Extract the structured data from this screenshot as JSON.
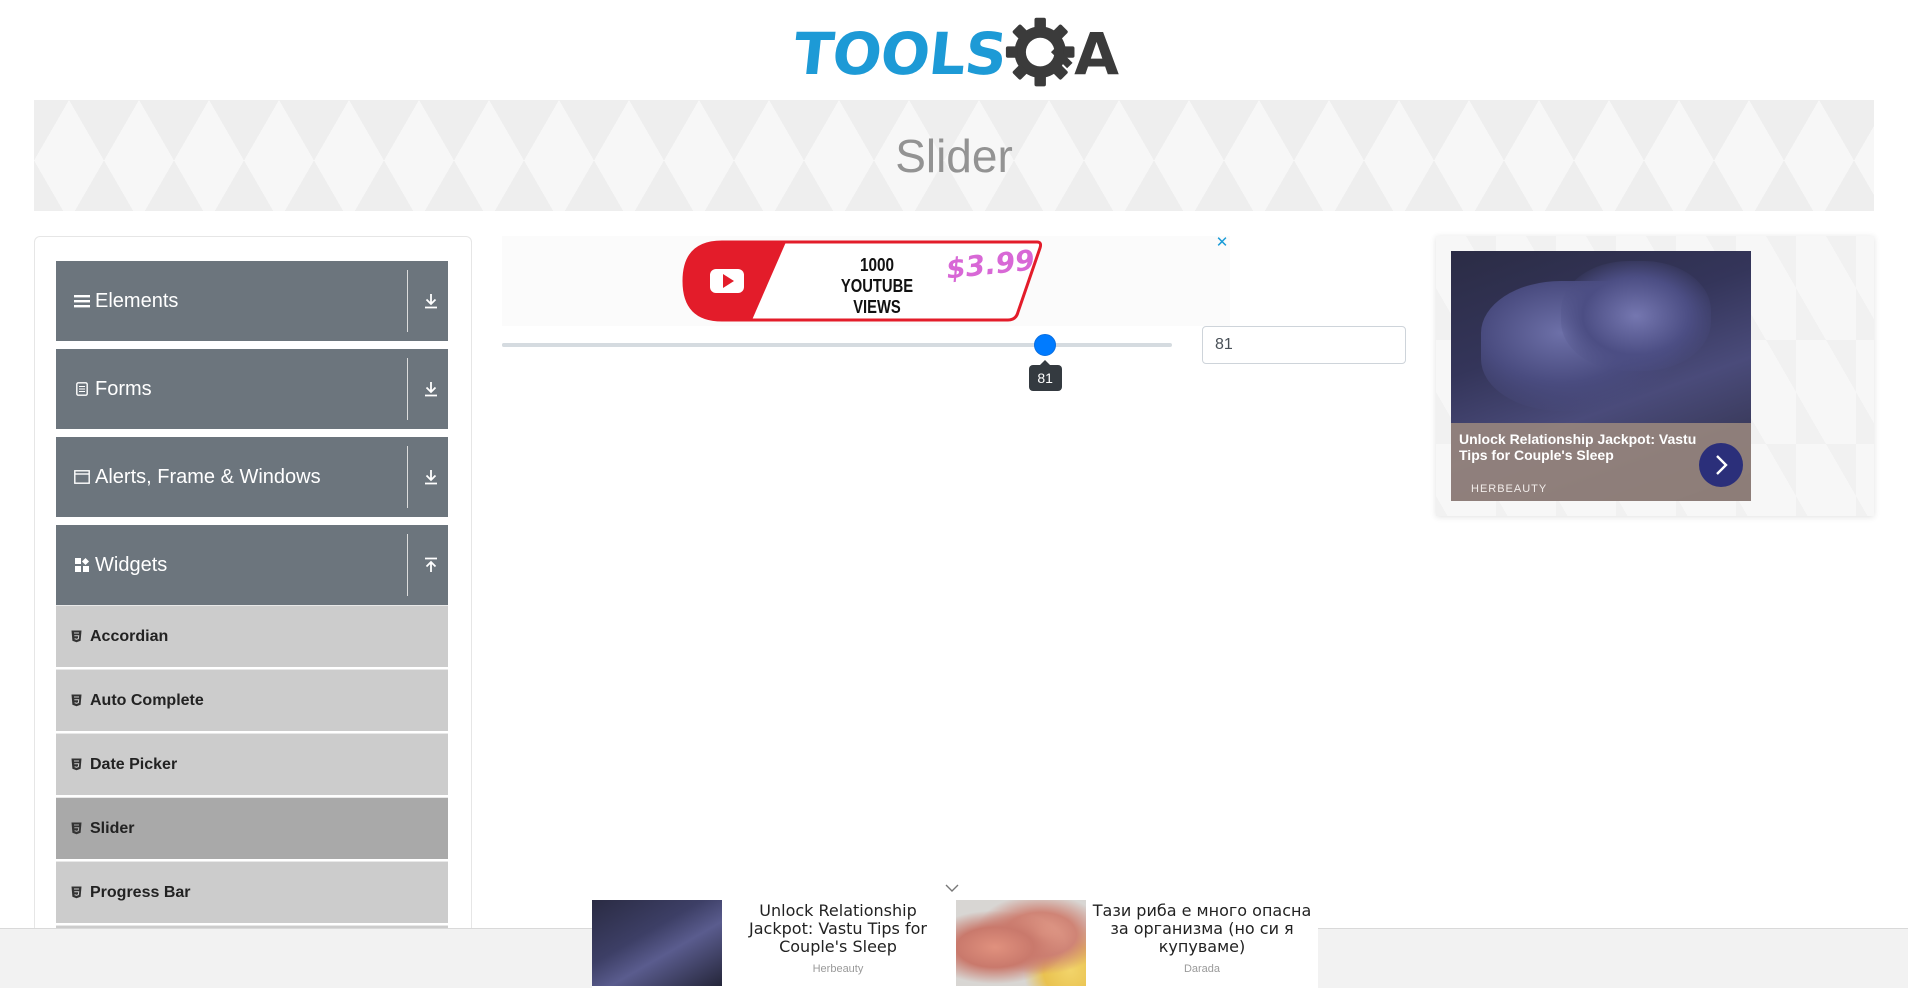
{
  "header": {
    "logo_tools": "TOOLS",
    "logo_a": "A"
  },
  "banner": {
    "title": "Slider"
  },
  "sidebar": {
    "groups": [
      {
        "label": "Elements",
        "icon": "list-icon",
        "state": "collapsed"
      },
      {
        "label": "Forms",
        "icon": "form-icon",
        "state": "collapsed"
      },
      {
        "label": "Alerts, Frame & Windows",
        "icon": "window-icon",
        "state": "collapsed"
      },
      {
        "label": "Widgets",
        "icon": "widgets-icon",
        "state": "expanded"
      }
    ],
    "items": [
      {
        "label": "Accordian"
      },
      {
        "label": "Auto Complete"
      },
      {
        "label": "Date Picker"
      },
      {
        "label": "Slider",
        "active": true
      },
      {
        "label": "Progress Bar"
      }
    ]
  },
  "top_ad": {
    "line1": "1000",
    "line2": "YOUTUBE VIEWS",
    "price": "$3.99",
    "close": "✕"
  },
  "slider": {
    "value": 81,
    "min": 0,
    "max": 100,
    "tooltip": "81",
    "input_value": "81",
    "thumb_color": "#007bff"
  },
  "right_ad": {
    "title": "Unlock Relationship Jackpot: Vastu Tips for Couple's Sleep",
    "brand": "HERBEAUTY"
  },
  "bottom_ad": {
    "items": [
      {
        "text": "Unlock Relationship Jackpot: Vastu Tips for Couple's Sleep",
        "brand": "Herbeauty"
      },
      {
        "text": "Тази риба е много опасна за организма (но си я купуваме)",
        "brand": "Darada"
      }
    ]
  },
  "colors": {
    "logo_blue": "#1d9ad6",
    "logo_dark": "#3b3b3b",
    "sidebar_group": "#6c757d",
    "sidebar_item": "#cccccc",
    "sidebar_item_active": "#a9a9a9"
  }
}
